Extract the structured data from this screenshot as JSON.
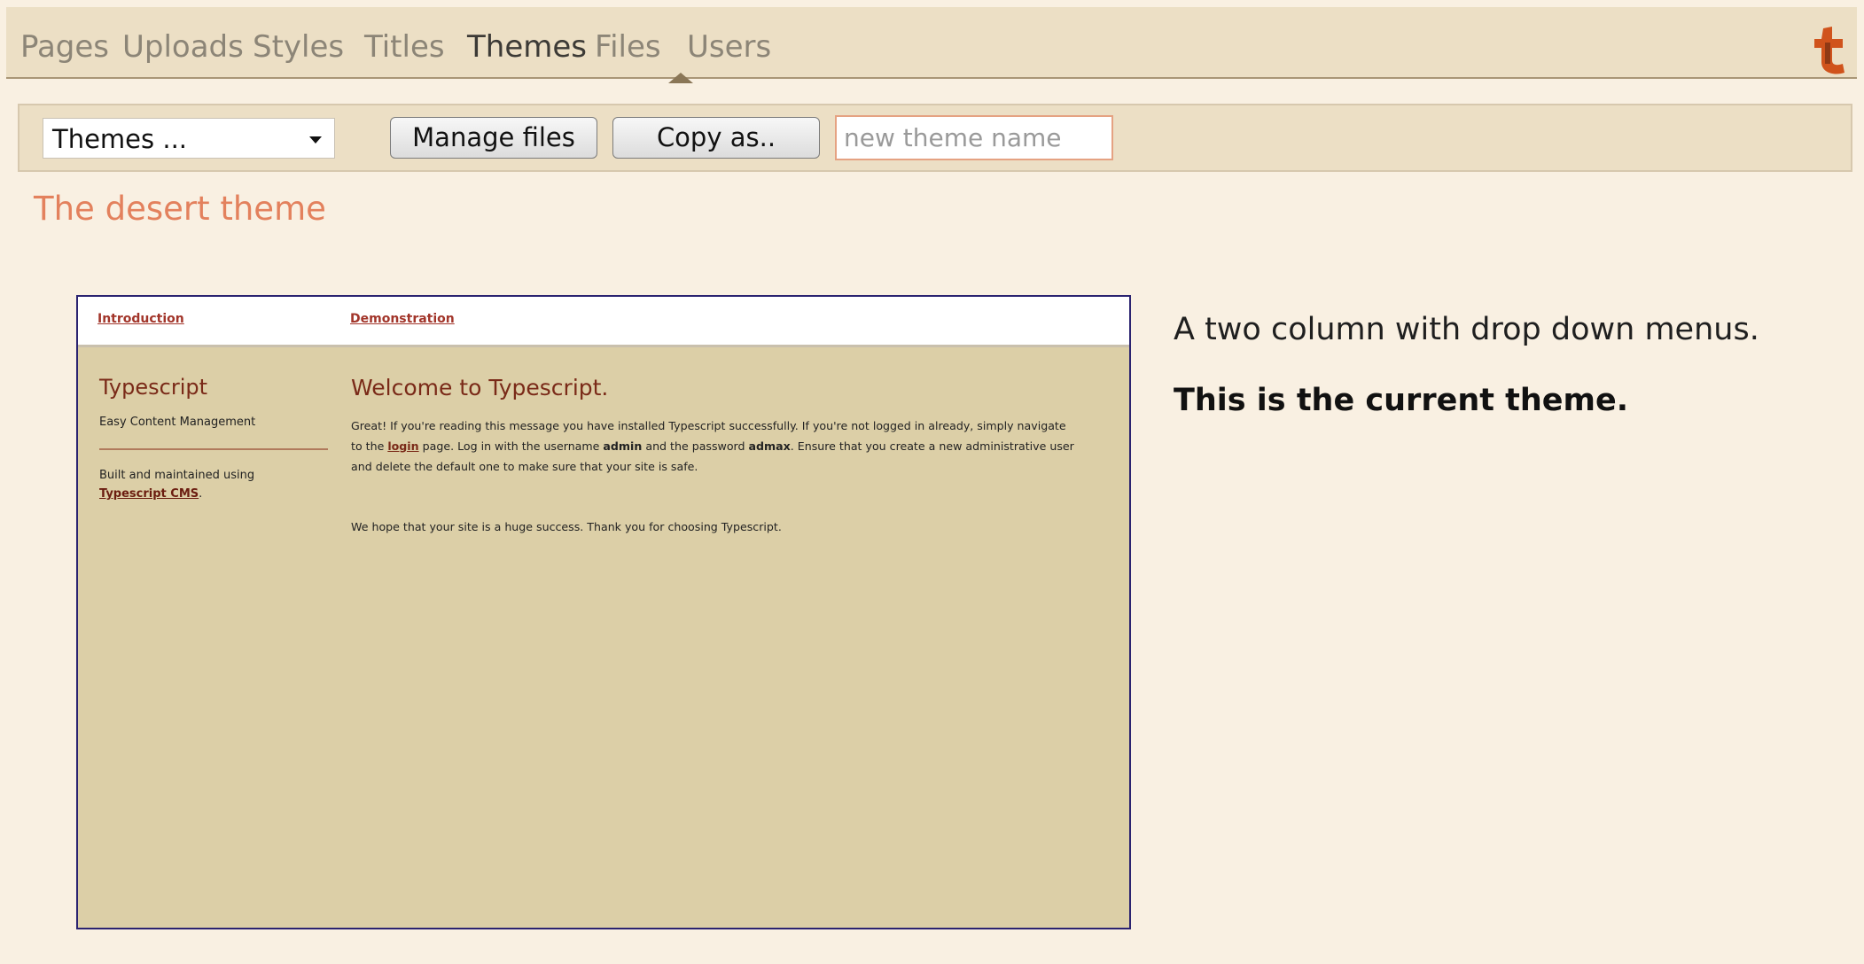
{
  "nav": {
    "tabs": [
      "Pages",
      "Uploads",
      "Styles",
      "Titles",
      "Themes",
      "Files",
      "Users"
    ],
    "active_tab": "Themes",
    "logo_icon": "typescript-logo-icon"
  },
  "toolbar": {
    "select_value": "Themes ...",
    "manage_files_label": "Manage files",
    "copy_as_label": "Copy as..",
    "new_theme_placeholder": "new theme name"
  },
  "theme": {
    "heading": "The desert theme",
    "description": "A two column with drop down menus.",
    "current_note": "This is the current theme."
  },
  "preview": {
    "nav_links": [
      "Introduction",
      "Demonstration"
    ],
    "side_title": "Typescript",
    "side_subtitle": "Easy Content Management",
    "built_text": "Built and maintained using",
    "built_link": "Typescript CMS",
    "built_suffix": ".",
    "main_title": "Welcome to Typescript.",
    "p1_part1": "Great! If you're reading this message you have installed Typescript successfully. If you're not logged in already, simply navigate to the ",
    "p1_login": "login",
    "p1_part2": " page. Log in with the username ",
    "p1_username": "admin",
    "p1_part3": " and the password ",
    "p1_password": "admax",
    "p1_part4": ". Ensure that you create a new administrative user and delete the default one to make sure that your site is safe.",
    "p2": "We hope that your site is a huge success. Thank you for choosing Typescript."
  },
  "colors": {
    "page_bg": "#f9f0e2",
    "nav_bg": "#ecdfc5",
    "heading_accent": "#e3815d",
    "preview_bg": "#dccfa7",
    "preview_border": "#2b2370",
    "preview_title": "#7a2a18"
  }
}
